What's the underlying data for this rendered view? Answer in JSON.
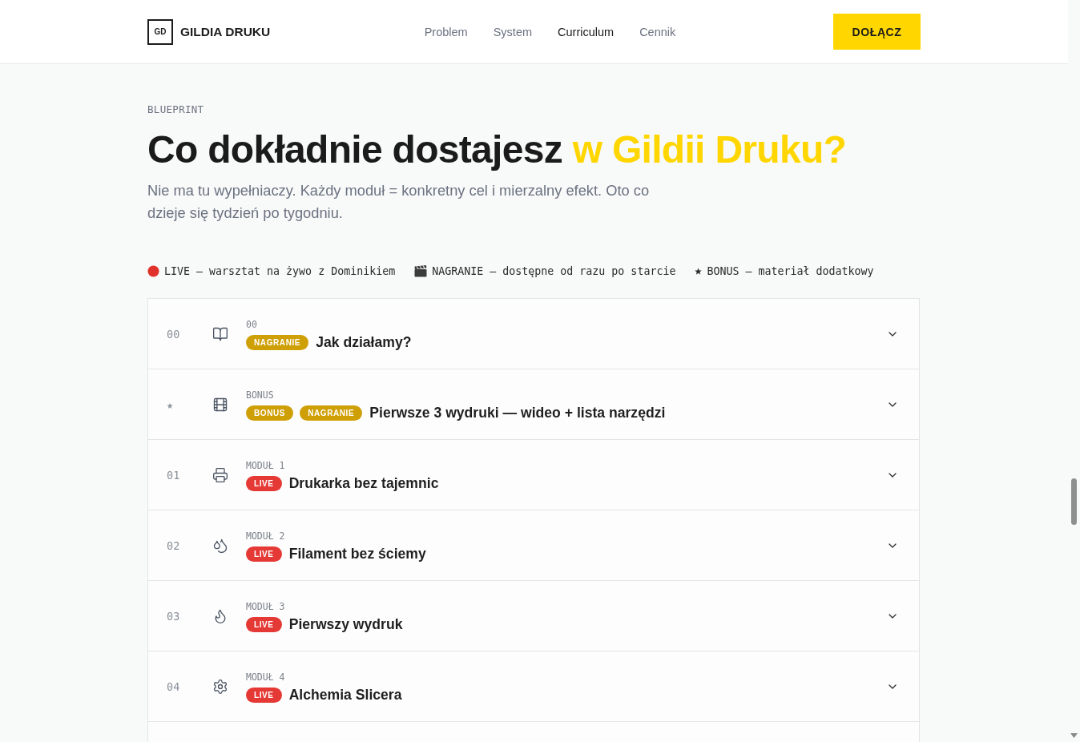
{
  "header": {
    "logo_mark": "GD",
    "brand": "GILDIA DRUKU",
    "nav": [
      {
        "label": "Problem",
        "selected": false
      },
      {
        "label": "System",
        "selected": false
      },
      {
        "label": "Curriculum",
        "selected": true
      },
      {
        "label": "Cennik",
        "selected": false
      }
    ],
    "cta": "DOŁĄCZ"
  },
  "intro": {
    "eyebrow": "BLUEPRINT",
    "heading": "Co dokładnie dostajesz",
    "heading_highlight": "w Gildii Druku?",
    "subtitle": "Nie ma tu wypełniaczy. Każdy moduł = konkretny cel i mierzalny efekt. Oto co dzieje się tydzień po tygodniu."
  },
  "legend": [
    {
      "kind": "live",
      "text": "LIVE — warsztat na żywo z Dominikiem"
    },
    {
      "kind": "recording",
      "text": "NAGRANIE — dostępne od razu po starcie"
    },
    {
      "kind": "bonus",
      "text": "BONUS — materiał dodatkowy"
    }
  ],
  "modules": [
    {
      "number": "00",
      "label": "00",
      "badges": [
        {
          "kind": "recording",
          "text": "NAGRANIE"
        }
      ],
      "title": "Jak działamy?",
      "expanded": false
    },
    {
      "number": "★",
      "label": "BONUS",
      "badges": [
        {
          "kind": "bonus",
          "text": "BONUS"
        },
        {
          "kind": "recording",
          "text": "NAGRANIE"
        }
      ],
      "title": "Pierwsze 3 wydruki — wideo + lista narzędzi",
      "expanded": false
    },
    {
      "number": "01",
      "label": "MODUŁ 1",
      "badges": [
        {
          "kind": "live",
          "text": "LIVE"
        }
      ],
      "title": "Drukarka bez tajemnic",
      "expanded": false
    },
    {
      "number": "02",
      "label": "MODUŁ 2",
      "badges": [
        {
          "kind": "live",
          "text": "LIVE"
        }
      ],
      "title": "Filament bez ściemy",
      "expanded": false
    },
    {
      "number": "03",
      "label": "MODUŁ 3",
      "badges": [
        {
          "kind": "live",
          "text": "LIVE"
        }
      ],
      "title": "Pierwszy wydruk",
      "expanded": false
    },
    {
      "number": "04",
      "label": "MODUŁ 4",
      "badges": [
        {
          "kind": "live",
          "text": "LIVE"
        }
      ],
      "title": "Alchemia Slicera",
      "expanded": false
    }
  ]
}
